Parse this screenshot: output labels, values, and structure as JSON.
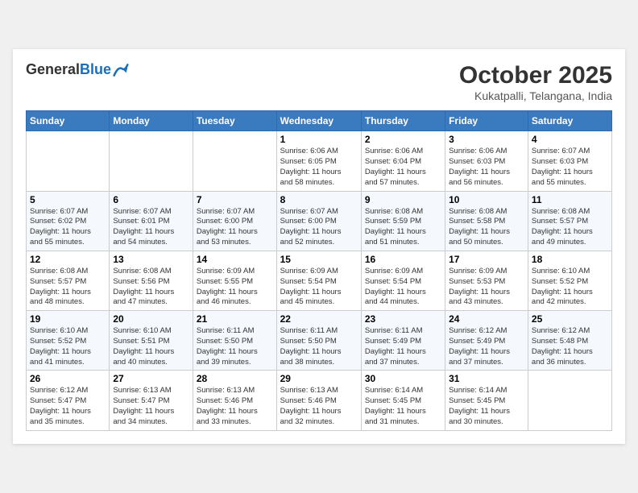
{
  "header": {
    "logo_general": "General",
    "logo_blue": "Blue",
    "month_title": "October 2025",
    "location": "Kukatpalli, Telangana, India"
  },
  "weekdays": [
    "Sunday",
    "Monday",
    "Tuesday",
    "Wednesday",
    "Thursday",
    "Friday",
    "Saturday"
  ],
  "weeks": [
    [
      {
        "day": "",
        "info": ""
      },
      {
        "day": "",
        "info": ""
      },
      {
        "day": "",
        "info": ""
      },
      {
        "day": "1",
        "info": "Sunrise: 6:06 AM\nSunset: 6:05 PM\nDaylight: 11 hours\nand 58 minutes."
      },
      {
        "day": "2",
        "info": "Sunrise: 6:06 AM\nSunset: 6:04 PM\nDaylight: 11 hours\nand 57 minutes."
      },
      {
        "day": "3",
        "info": "Sunrise: 6:06 AM\nSunset: 6:03 PM\nDaylight: 11 hours\nand 56 minutes."
      },
      {
        "day": "4",
        "info": "Sunrise: 6:07 AM\nSunset: 6:03 PM\nDaylight: 11 hours\nand 55 minutes."
      }
    ],
    [
      {
        "day": "5",
        "info": "Sunrise: 6:07 AM\nSunset: 6:02 PM\nDaylight: 11 hours\nand 55 minutes."
      },
      {
        "day": "6",
        "info": "Sunrise: 6:07 AM\nSunset: 6:01 PM\nDaylight: 11 hours\nand 54 minutes."
      },
      {
        "day": "7",
        "info": "Sunrise: 6:07 AM\nSunset: 6:00 PM\nDaylight: 11 hours\nand 53 minutes."
      },
      {
        "day": "8",
        "info": "Sunrise: 6:07 AM\nSunset: 6:00 PM\nDaylight: 11 hours\nand 52 minutes."
      },
      {
        "day": "9",
        "info": "Sunrise: 6:08 AM\nSunset: 5:59 PM\nDaylight: 11 hours\nand 51 minutes."
      },
      {
        "day": "10",
        "info": "Sunrise: 6:08 AM\nSunset: 5:58 PM\nDaylight: 11 hours\nand 50 minutes."
      },
      {
        "day": "11",
        "info": "Sunrise: 6:08 AM\nSunset: 5:57 PM\nDaylight: 11 hours\nand 49 minutes."
      }
    ],
    [
      {
        "day": "12",
        "info": "Sunrise: 6:08 AM\nSunset: 5:57 PM\nDaylight: 11 hours\nand 48 minutes."
      },
      {
        "day": "13",
        "info": "Sunrise: 6:08 AM\nSunset: 5:56 PM\nDaylight: 11 hours\nand 47 minutes."
      },
      {
        "day": "14",
        "info": "Sunrise: 6:09 AM\nSunset: 5:55 PM\nDaylight: 11 hours\nand 46 minutes."
      },
      {
        "day": "15",
        "info": "Sunrise: 6:09 AM\nSunset: 5:54 PM\nDaylight: 11 hours\nand 45 minutes."
      },
      {
        "day": "16",
        "info": "Sunrise: 6:09 AM\nSunset: 5:54 PM\nDaylight: 11 hours\nand 44 minutes."
      },
      {
        "day": "17",
        "info": "Sunrise: 6:09 AM\nSunset: 5:53 PM\nDaylight: 11 hours\nand 43 minutes."
      },
      {
        "day": "18",
        "info": "Sunrise: 6:10 AM\nSunset: 5:52 PM\nDaylight: 11 hours\nand 42 minutes."
      }
    ],
    [
      {
        "day": "19",
        "info": "Sunrise: 6:10 AM\nSunset: 5:52 PM\nDaylight: 11 hours\nand 41 minutes."
      },
      {
        "day": "20",
        "info": "Sunrise: 6:10 AM\nSunset: 5:51 PM\nDaylight: 11 hours\nand 40 minutes."
      },
      {
        "day": "21",
        "info": "Sunrise: 6:11 AM\nSunset: 5:50 PM\nDaylight: 11 hours\nand 39 minutes."
      },
      {
        "day": "22",
        "info": "Sunrise: 6:11 AM\nSunset: 5:50 PM\nDaylight: 11 hours\nand 38 minutes."
      },
      {
        "day": "23",
        "info": "Sunrise: 6:11 AM\nSunset: 5:49 PM\nDaylight: 11 hours\nand 37 minutes."
      },
      {
        "day": "24",
        "info": "Sunrise: 6:12 AM\nSunset: 5:49 PM\nDaylight: 11 hours\nand 37 minutes."
      },
      {
        "day": "25",
        "info": "Sunrise: 6:12 AM\nSunset: 5:48 PM\nDaylight: 11 hours\nand 36 minutes."
      }
    ],
    [
      {
        "day": "26",
        "info": "Sunrise: 6:12 AM\nSunset: 5:47 PM\nDaylight: 11 hours\nand 35 minutes."
      },
      {
        "day": "27",
        "info": "Sunrise: 6:13 AM\nSunset: 5:47 PM\nDaylight: 11 hours\nand 34 minutes."
      },
      {
        "day": "28",
        "info": "Sunrise: 6:13 AM\nSunset: 5:46 PM\nDaylight: 11 hours\nand 33 minutes."
      },
      {
        "day": "29",
        "info": "Sunrise: 6:13 AM\nSunset: 5:46 PM\nDaylight: 11 hours\nand 32 minutes."
      },
      {
        "day": "30",
        "info": "Sunrise: 6:14 AM\nSunset: 5:45 PM\nDaylight: 11 hours\nand 31 minutes."
      },
      {
        "day": "31",
        "info": "Sunrise: 6:14 AM\nSunset: 5:45 PM\nDaylight: 11 hours\nand 30 minutes."
      },
      {
        "day": "",
        "info": ""
      }
    ]
  ]
}
